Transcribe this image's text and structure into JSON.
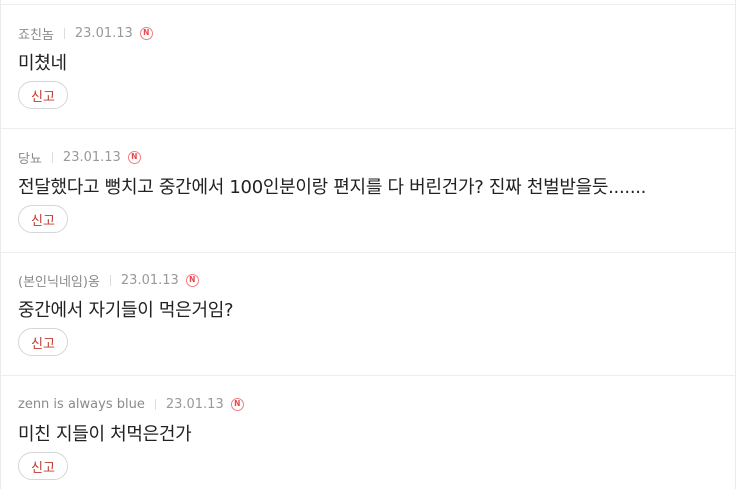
{
  "comments": [
    {
      "author": "죠친놈",
      "date": "23.01.13",
      "new_badge": "N",
      "text": "미쳤네",
      "report_label": "신고"
    },
    {
      "author": "당뇨",
      "date": "23.01.13",
      "new_badge": "N",
      "text": "전달했다고 뻥치고 중간에서 100인분이랑 편지를 다 버린건가? 진짜 천벌받을듯.......",
      "report_label": "신고"
    },
    {
      "author": "(본인닉네임)옹",
      "date": "23.01.13",
      "new_badge": "N",
      "text": "중간에서 자기들이 먹은거임?",
      "report_label": "신고"
    },
    {
      "author": "zenn is always blue",
      "date": "23.01.13",
      "new_badge": "N",
      "text": "미친 지들이 처먹은건가",
      "report_label": "신고"
    }
  ],
  "colors": {
    "report_text": "#c0392b",
    "badge": "#e8464a",
    "meta_text": "#999999",
    "body_text": "#222222"
  },
  "icons": {
    "new_badge": "new-badge-icon"
  }
}
